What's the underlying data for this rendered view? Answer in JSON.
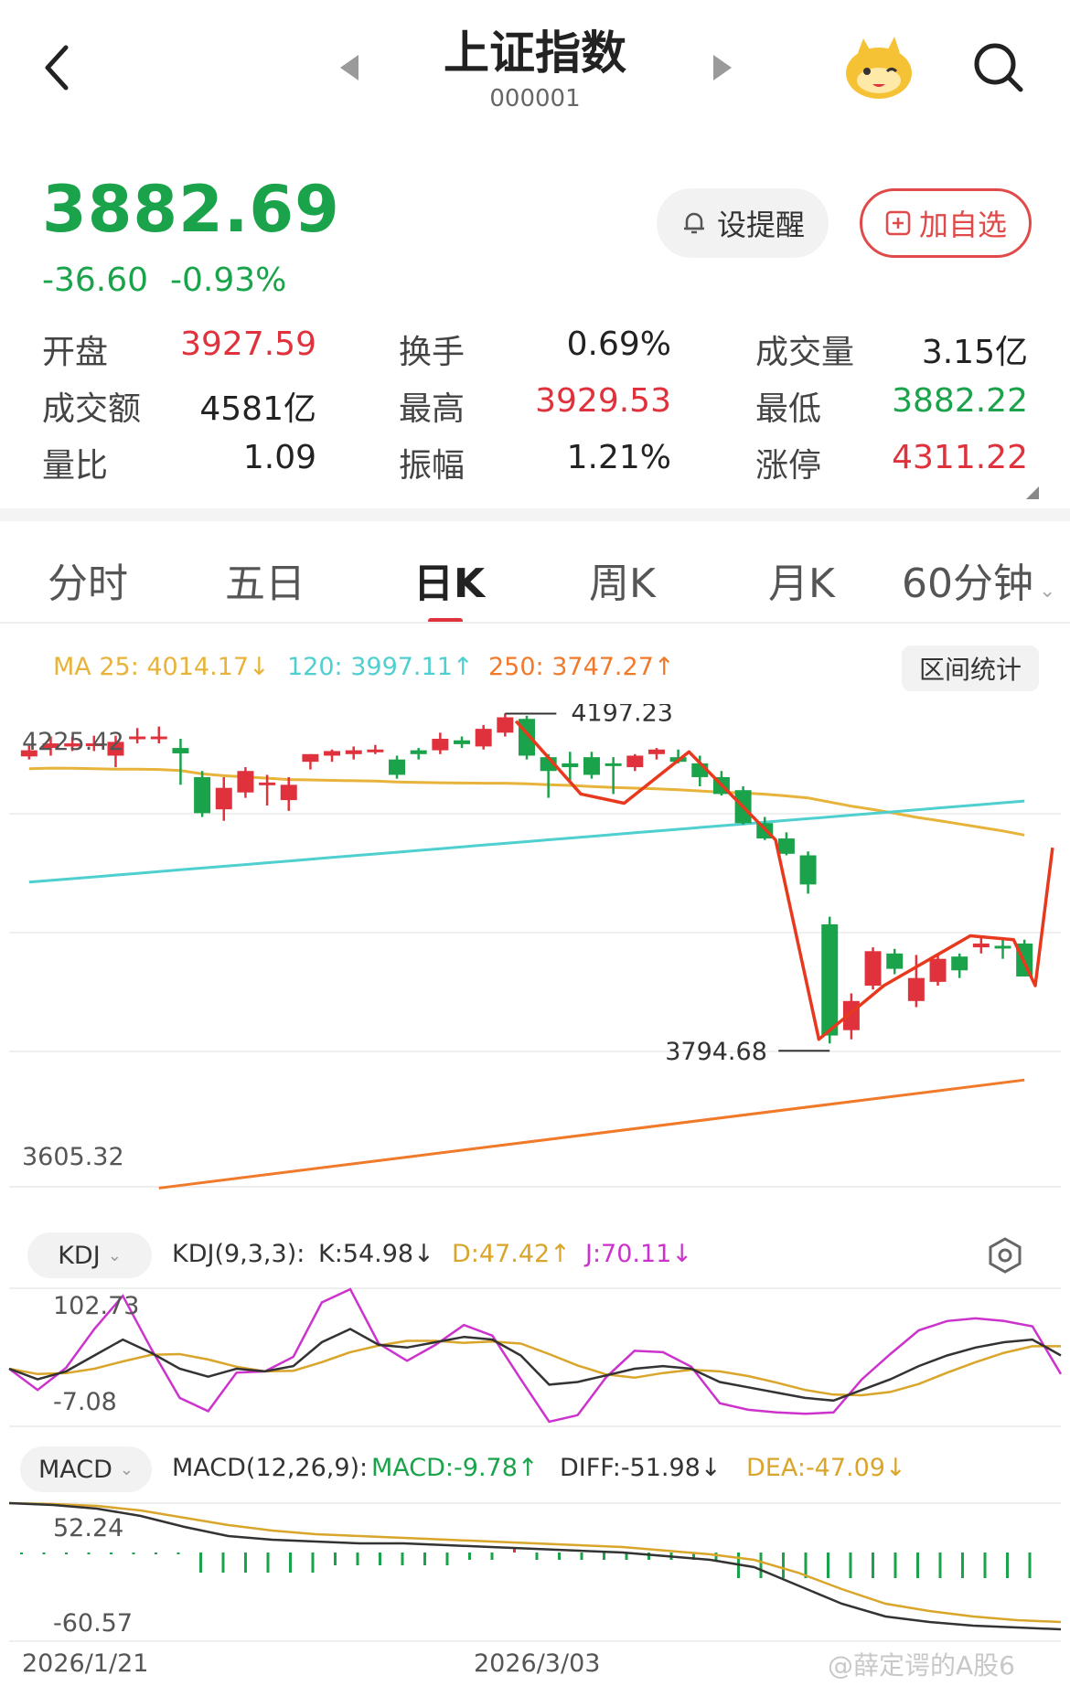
{
  "header": {
    "title": "上证指数",
    "code": "000001"
  },
  "quote": {
    "price": "3882.69",
    "change": "-36.60",
    "change_pct": "-0.93%"
  },
  "actions": {
    "alert_label": "设提醒",
    "watchlist_label": "加自选"
  },
  "stats": [
    {
      "label": "开盘",
      "value": "3927.59",
      "color": "#e0323c"
    },
    {
      "label": "换手",
      "value": "0.69%",
      "color": "#222222"
    },
    {
      "label": "成交量",
      "value": "3.15亿",
      "color": "#222222"
    },
    {
      "label": "成交额",
      "value": "4581亿",
      "color": "#222222"
    },
    {
      "label": "最高",
      "value": "3929.53",
      "color": "#e0323c"
    },
    {
      "label": "最低",
      "value": "3882.22",
      "color": "#1aa34a"
    },
    {
      "label": "量比",
      "value": "1.09",
      "color": "#222222"
    },
    {
      "label": "振幅",
      "value": "1.21%",
      "color": "#222222"
    },
    {
      "label": "涨停",
      "value": "4311.22",
      "color": "#e0323c"
    }
  ],
  "tabs": [
    "分时",
    "五日",
    "日K",
    "周K",
    "月K",
    "60分钟"
  ],
  "active_tab": "日K",
  "ma_legend": {
    "ma25": "MA 25: 4014.17↓",
    "ma120": "120: 3997.11↑",
    "ma250": "250: 3747.27↑"
  },
  "range_stats_label": "区间统计",
  "chart_data": {
    "type": "candlestick",
    "axis_top_label": "4225.42",
    "axis_bottom_label": "3605.32",
    "ylim": [
      3605.32,
      4225.42
    ],
    "high_marker": "4197.23",
    "low_marker": "3794.68",
    "candles": [
      {
        "o": 4169,
        "h": 4183,
        "l": 4165,
        "c": 4177,
        "up": true
      },
      {
        "o": 4180,
        "h": 4195,
        "l": 4170,
        "c": 4186,
        "up": true
      },
      {
        "o": 4182,
        "h": 4195,
        "l": 4176,
        "c": 4186,
        "up": true
      },
      {
        "o": 4186,
        "h": 4196,
        "l": 4176,
        "c": 4186,
        "up": true
      },
      {
        "o": 4170,
        "h": 4196,
        "l": 4155,
        "c": 4188,
        "up": true
      },
      {
        "o": 4195,
        "h": 4206,
        "l": 4186,
        "c": 4195,
        "up": true
      },
      {
        "o": 4195,
        "h": 4208,
        "l": 4186,
        "c": 4195,
        "up": true
      },
      {
        "o": 4180,
        "h": 4192,
        "l": 4132,
        "c": 4173,
        "up": false
      },
      {
        "o": 4142,
        "h": 4150,
        "l": 4090,
        "c": 4095,
        "up": false
      },
      {
        "o": 4100,
        "h": 4142,
        "l": 4085,
        "c": 4128,
        "up": true
      },
      {
        "o": 4122,
        "h": 4155,
        "l": 4115,
        "c": 4150,
        "up": true
      },
      {
        "o": 4135,
        "h": 4145,
        "l": 4105,
        "c": 4135,
        "up": true
      },
      {
        "o": 4112,
        "h": 4142,
        "l": 4098,
        "c": 4132,
        "up": true
      },
      {
        "o": 4162,
        "h": 4172,
        "l": 4152,
        "c": 4172,
        "up": true
      },
      {
        "o": 4170,
        "h": 4178,
        "l": 4162,
        "c": 4176,
        "up": true
      },
      {
        "o": 4172,
        "h": 4182,
        "l": 4165,
        "c": 4177,
        "up": true
      },
      {
        "o": 4178,
        "h": 4184,
        "l": 4172,
        "c": 4178,
        "up": true
      },
      {
        "o": 4165,
        "h": 4170,
        "l": 4140,
        "c": 4145,
        "up": false
      },
      {
        "o": 4172,
        "h": 4180,
        "l": 4165,
        "c": 4177,
        "up": false
      },
      {
        "o": 4177,
        "h": 4200,
        "l": 4172,
        "c": 4192,
        "up": true
      },
      {
        "o": 4185,
        "h": 4195,
        "l": 4180,
        "c": 4190,
        "up": false
      },
      {
        "o": 4182,
        "h": 4210,
        "l": 4178,
        "c": 4205,
        "up": true
      },
      {
        "o": 4200,
        "h": 4225,
        "l": 4195,
        "c": 4220,
        "up": true
      },
      {
        "o": 4218,
        "h": 4222,
        "l": 4165,
        "c": 4170,
        "up": false
      },
      {
        "o": 4168,
        "h": 4172,
        "l": 4115,
        "c": 4150,
        "up": false
      },
      {
        "o": 4155,
        "h": 4175,
        "l": 4135,
        "c": 4160,
        "up": false
      },
      {
        "o": 4168,
        "h": 4175,
        "l": 4140,
        "c": 4145,
        "up": false
      },
      {
        "o": 4160,
        "h": 4168,
        "l": 4120,
        "c": 4158,
        "up": false
      },
      {
        "o": 4155,
        "h": 4172,
        "l": 4150,
        "c": 4170,
        "up": true
      },
      {
        "o": 4172,
        "h": 4180,
        "l": 4165,
        "c": 4178,
        "up": true
      },
      {
        "o": 4168,
        "h": 4178,
        "l": 4160,
        "c": 4162,
        "up": false
      },
      {
        "o": 4160,
        "h": 4170,
        "l": 4130,
        "c": 4142,
        "up": false
      },
      {
        "o": 4142,
        "h": 4150,
        "l": 4118,
        "c": 4120,
        "up": false
      },
      {
        "o": 4125,
        "h": 4130,
        "l": 4080,
        "c": 4082,
        "up": false
      },
      {
        "o": 4082,
        "h": 4090,
        "l": 4060,
        "c": 4062,
        "up": false
      },
      {
        "o": 4062,
        "h": 4070,
        "l": 4040,
        "c": 4042,
        "up": false
      },
      {
        "o": 4040,
        "h": 4045,
        "l": 3990,
        "c": 4002,
        "up": false
      },
      {
        "o": 3950,
        "h": 3960,
        "l": 3794.68,
        "c": 3805,
        "up": false
      },
      {
        "o": 3812,
        "h": 3860,
        "l": 3800,
        "c": 3850,
        "up": true
      },
      {
        "o": 3870,
        "h": 3920,
        "l": 3865,
        "c": 3915,
        "up": true
      },
      {
        "o": 3912,
        "h": 3918,
        "l": 3885,
        "c": 3892,
        "up": false
      },
      {
        "o": 3880,
        "h": 3910,
        "l": 3842,
        "c": 3850,
        "up": true
      },
      {
        "o": 3875,
        "h": 3912,
        "l": 3870,
        "c": 3905,
        "up": true
      },
      {
        "o": 3890,
        "h": 3912,
        "l": 3880,
        "c": 3908,
        "up": false
      },
      {
        "o": 3925,
        "h": 3935,
        "l": 3912,
        "c": 3920,
        "up": true
      },
      {
        "o": 3920,
        "h": 3930,
        "l": 3905,
        "c": 3922,
        "up": false
      },
      {
        "o": 3925,
        "h": 3930,
        "l": 3882,
        "c": 3882,
        "up": false
      }
    ]
  },
  "kdj": {
    "button_label": "KDJ",
    "title": "KDJ(9,3,3):",
    "k": "K:54.98↓",
    "d": "D:47.42↑",
    "j": "J:70.11↓",
    "axis_top": "102.73",
    "axis_bottom": "-7.08"
  },
  "macd": {
    "button_label": "MACD",
    "title": "MACD(12,26,9):",
    "macd": "MACD:-9.78↑",
    "diff": "DIFF:-51.98↓",
    "dea": "DEA:-47.09↓",
    "axis_top": "52.24",
    "axis_bottom": "-60.57"
  },
  "dates": [
    "2026/1/21",
    "2026/3/03"
  ],
  "watermark": "@薛定谔的A股6",
  "colors": {
    "up": "#e0323c",
    "down": "#1aa34a",
    "ma25": "#e8b33a",
    "ma120": "#4fcfcf",
    "ma250": "#f07a2a",
    "annotation": "#e8391f",
    "kdj_k": "#333333",
    "kdj_d": "#d9a52a",
    "kdj_j": "#cc33cc"
  }
}
